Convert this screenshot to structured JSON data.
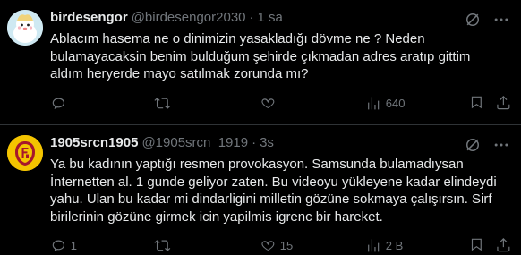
{
  "tweets": [
    {
      "display_name": "birdesengor",
      "handle": "@birdesengor2030",
      "separator": "·",
      "time": "1 sa",
      "text": "Ablacım hasema ne o dinimizin yasakladığı dövme ne ? Neden\nbulamayacaksin benim bulduğum şehirde çıkmadan adres aratıp gittim\naldım heryerde mayo satılmak zorunda mı?",
      "actions": {
        "reply": "",
        "retweet": "",
        "like": "",
        "views": "640"
      },
      "avatar_icon": "cartoon-character-avatar"
    },
    {
      "display_name": "1905srcn1905",
      "handle": "@1905srcn_1919",
      "separator": "·",
      "time": "3s",
      "text": "Ya bu kadının yaptığı resmen provokasyon. Samsunda bulamadıysan\nİnternetten al. 1 gunde geliyor zaten. Bu videoyu yükleyene kadar elindeydi\nyahu. Ulan bu kadar mi dindarligini milletin gözüne sokmaya çalışırsın. Sirf\nbirilerinin gözüne girmek icin yapilmis igrenc bir hareket.",
      "actions": {
        "reply": "1",
        "retweet": "",
        "like": "15",
        "views": "2 B"
      },
      "avatar_icon": "galatasaray-logo-avatar"
    }
  ],
  "colors": {
    "background": "#000000",
    "text": "#e7e9ea",
    "secondary": "#71767b",
    "divider": "#2f3336"
  }
}
